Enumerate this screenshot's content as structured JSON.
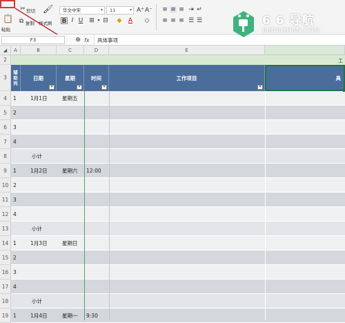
{
  "ribbon": {
    "font_name": "华文中宋",
    "font_size": "11",
    "grow_icon": "A⁺",
    "shrink_icon": "A⁻",
    "cut_label": "剪切",
    "copy_label": "复制",
    "format_label": "格式刷",
    "paste_label": "粘贴",
    "bold": "B",
    "underline": "U"
  },
  "formula_bar": {
    "name_box": "F3",
    "fx": "fx",
    "content": "具体事项"
  },
  "columns": [
    "A",
    "B",
    "C",
    "D",
    "E"
  ],
  "header": {
    "a": "辅助列",
    "b": "日期",
    "c": "星期",
    "d": "时间",
    "e": "工作项目",
    "f": "具",
    "top_f": "工"
  },
  "rows": [
    {
      "num": "2"
    },
    {
      "num": "3"
    },
    {
      "num": "4",
      "a": "1",
      "b": "1月1日",
      "c": "星期五",
      "d": ""
    },
    {
      "num": "5",
      "a": "2"
    },
    {
      "num": "6",
      "a": "3"
    },
    {
      "num": "7",
      "a": "4"
    },
    {
      "num": "8",
      "b": "小计"
    },
    {
      "num": "9",
      "a": "1",
      "b": "1月2日",
      "c": "星期六",
      "d": "12:00"
    },
    {
      "num": "10",
      "a": "2"
    },
    {
      "num": "11",
      "a": "3"
    },
    {
      "num": "12",
      "a": "4"
    },
    {
      "num": "13",
      "b": "小计"
    },
    {
      "num": "14",
      "a": "1",
      "b": "1月3日",
      "c": "星期日"
    },
    {
      "num": "15",
      "a": "2"
    },
    {
      "num": "16",
      "a": "3"
    },
    {
      "num": "17",
      "a": "4"
    },
    {
      "num": "18",
      "b": "小计"
    },
    {
      "num": "19",
      "a": "1",
      "b": "1月4日",
      "c": "星期一",
      "d": "9:30"
    }
  ],
  "watermark": {
    "title": "6 6 导航",
    "url": "66DAOHAN.COM"
  },
  "colors": {
    "header_blue": "#4a6d9c",
    "row_gray": "#d4d7db",
    "row_light": "#eef0f2",
    "subtotal": "#e3e5e8",
    "selection": "#217346",
    "logo_green": "#3fb37f",
    "arrow_red": "#c0272d"
  }
}
